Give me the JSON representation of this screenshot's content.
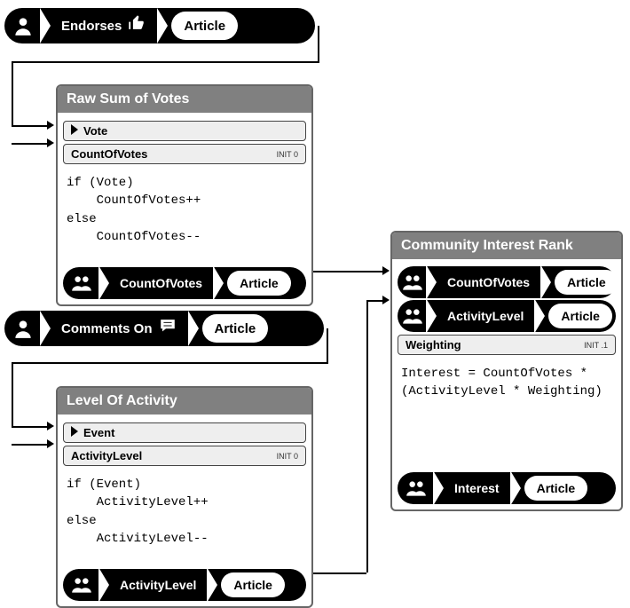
{
  "event_endorse": {
    "action": "Endorses",
    "object": "Article",
    "actor_icon": "user-icon",
    "action_icon": "thumbs-up-icon"
  },
  "event_comment": {
    "action": "Comments On",
    "object": "Article",
    "actor_icon": "user-icon",
    "action_icon": "speech-bubble-icon"
  },
  "box_votes": {
    "title": "Raw Sum of Votes",
    "input_port": "Vote",
    "state_port": "CountOfVotes",
    "state_tag": "INIT\n0",
    "code": "if (Vote)\n    CountOfVotes++\nelse\n    CountOfVotes--",
    "output_field": "CountOfVotes",
    "output_object": "Article",
    "output_icon": "group-icon"
  },
  "box_activity": {
    "title": "Level Of Activity",
    "input_port": "Event",
    "state_port": "ActivityLevel",
    "state_tag": "INIT\n0",
    "code": "if (Event)\n    ActivityLevel++\nelse\n    ActivityLevel--",
    "output_field": "ActivityLevel",
    "output_object": "Article",
    "output_icon": "group-icon"
  },
  "box_rank": {
    "title": "Community Interest Rank",
    "input1_field": "CountOfVotes",
    "input1_object": "Article",
    "input2_field": "ActivityLevel",
    "input2_object": "Article",
    "state_port": "Weighting",
    "state_tag": "INIT\n.1",
    "code": "Interest = CountOfVotes * \n(ActivityLevel * Weighting)",
    "output_field": "Interest",
    "output_object": "Article",
    "icon": "group-icon"
  }
}
